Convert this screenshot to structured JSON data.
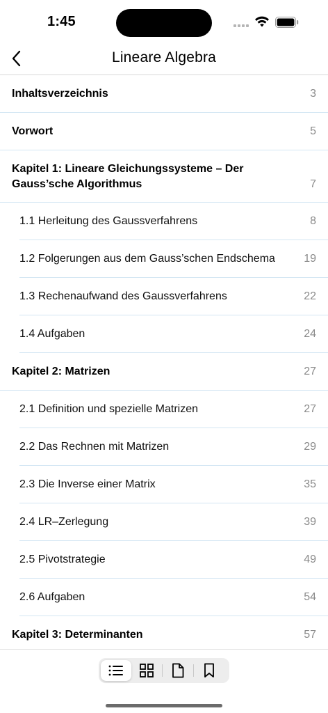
{
  "status_bar": {
    "time": "1:45"
  },
  "nav": {
    "title": "Lineare Algebra",
    "back_icon": "chevron-left-icon"
  },
  "toc": {
    "items": [
      {
        "type": "chapter",
        "title": "Inhaltsverzeichnis",
        "page": "3"
      },
      {
        "type": "chapter",
        "title": "Vorwort",
        "page": "5"
      },
      {
        "type": "chapter",
        "title": "Kapitel 1: Lineare Gleichungssysteme – Der Gauss’sche Algorithmus",
        "page": "7"
      },
      {
        "type": "section",
        "title": "1.1 Herleitung des Gaussverfahrens",
        "page": "8"
      },
      {
        "type": "section",
        "title": "1.2 Folgerungen aus dem Gauss’schen Endschema",
        "page": "19"
      },
      {
        "type": "section",
        "title": "1.3 Rechenaufwand des Gaussverfahrens",
        "page": "22"
      },
      {
        "type": "section",
        "title": "1.4 Aufgaben",
        "page": "24"
      },
      {
        "type": "chapter",
        "title": "Kapitel 2: Matrizen",
        "page": "27"
      },
      {
        "type": "section",
        "title": "2.1 Definition und spezielle Matrizen",
        "page": "27"
      },
      {
        "type": "section",
        "title": "2.2 Das Rechnen mit Matrizen",
        "page": "29"
      },
      {
        "type": "section",
        "title": "2.3 Die Inverse einer Matrix",
        "page": "35"
      },
      {
        "type": "section",
        "title": "2.4 LR–Zerlegung",
        "page": "39"
      },
      {
        "type": "section",
        "title": "2.5 Pivotstrategie",
        "page": "49"
      },
      {
        "type": "section",
        "title": "2.6 Aufgaben",
        "page": "54"
      },
      {
        "type": "chapter",
        "title": "Kapitel 3: Determinanten",
        "page": "57"
      }
    ]
  },
  "toolbar": {
    "segments": [
      {
        "icon": "list-icon",
        "active": true
      },
      {
        "icon": "grid-icon",
        "active": false
      },
      {
        "icon": "page-icon",
        "active": false
      },
      {
        "icon": "bookmark-icon",
        "active": false
      }
    ]
  },
  "colors": {
    "separator": "#d3e6f3",
    "page_number": "#8a8a8a"
  }
}
